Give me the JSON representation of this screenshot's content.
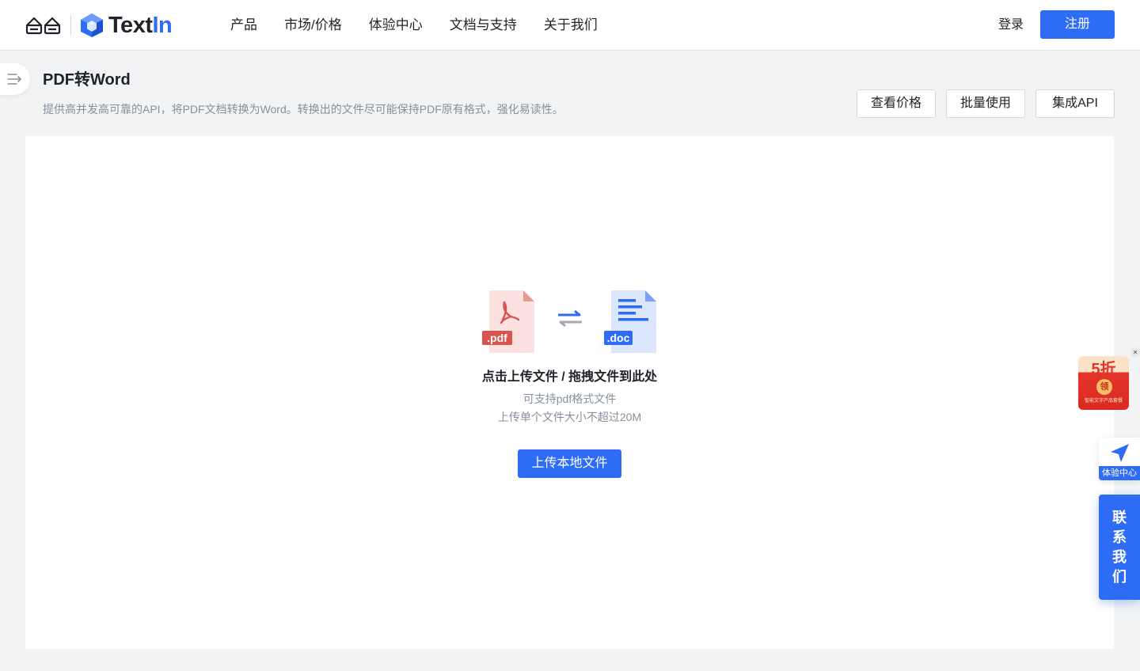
{
  "header": {
    "brand_prefix": "Text",
    "brand_suffix": "In",
    "nav": [
      "产品",
      "市场/价格",
      "体验中心",
      "文档与支持",
      "关于我们"
    ],
    "login_label": "登录",
    "register_label": "注册"
  },
  "page": {
    "title": "PDF转Word",
    "description": "提供高并发高可靠的API，将PDF文档转换为Word。转换出的文件尽可能保持PDF原有格式，强化易读性。",
    "actions": {
      "price_label": "查看价格",
      "batch_label": "批量使用",
      "api_label": "集成API"
    }
  },
  "upload": {
    "pdf_tag": ".pdf",
    "doc_tag": ".doc",
    "title": "点击上传文件 / 拖拽文件到此处",
    "hint_format": "可支持pdf格式文件",
    "hint_size": "上传单个文件大小不超过20M",
    "button_label": "上传本地文件"
  },
  "floating": {
    "promo_text": "5折",
    "promo_coin": "领",
    "promo_sub": "智能文字产品套餐",
    "promo_close": "×",
    "experience_label": "体验中心",
    "contact_chars": [
      "联",
      "系",
      "我",
      "们"
    ]
  },
  "colors": {
    "primary": "#2f6cf6",
    "pdf_red": "#d9534f",
    "promo_red": "#e5352b"
  },
  "icons": {
    "sidebar_toggle": "expand-menu-icon",
    "swap": "swap-arrows-icon",
    "experience": "send-arrow-icon"
  }
}
